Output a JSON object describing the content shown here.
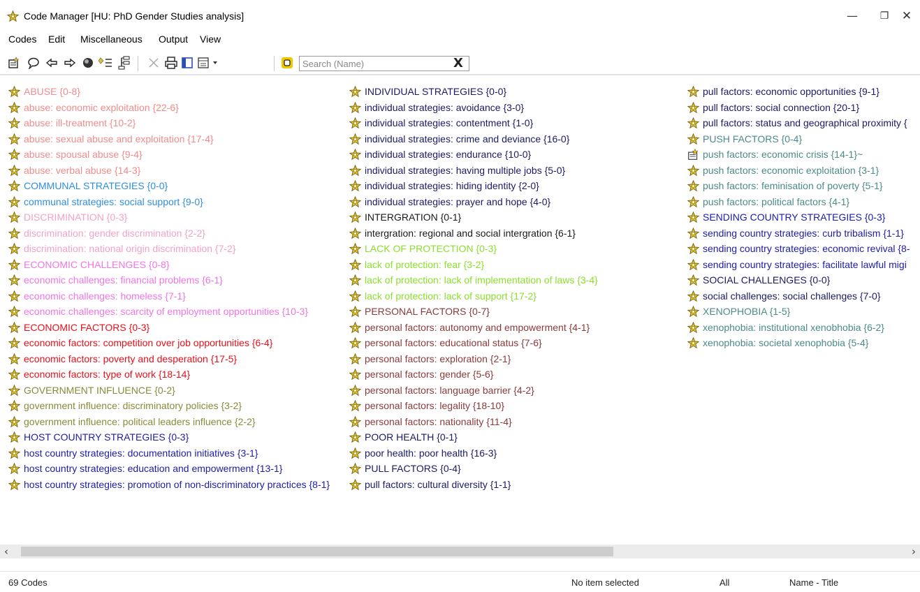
{
  "window": {
    "title": "Code Manager [HU: PhD Gender Studies analysis]",
    "controls": {
      "minimize": "—",
      "maximize": "❐",
      "close": "✕"
    }
  },
  "menubar": [
    "Codes",
    "Edit",
    "Miscellaneous",
    "Output",
    "View"
  ],
  "toolbar": {
    "icons": [
      "new-code-icon",
      "comment-icon",
      "arrow-left-icon",
      "arrow-right-icon",
      "color-icon",
      "filter-icon",
      "tree-icon",
      "delete-icon",
      "print-icon",
      "panel-icon",
      "view-dropdown-icon",
      "highlight-icon"
    ],
    "search": {
      "placeholder": "Search (Name)",
      "value": "",
      "clear": "X"
    }
  },
  "colors": {
    "abuse": "#f28b8b",
    "communal": "#2f8fe0",
    "discrimination": "#f2a2c8",
    "economic_challenges": "#f075e6",
    "economic_factors": "#e8101a",
    "government": "#8a8a3a",
    "host_country": "#1c1ca8",
    "individual": "#1a1a66",
    "lack_of_protection": "#8ae02a",
    "personal_factors": "#8a3a3a",
    "poor_health": "#1a1a66",
    "pull_factors": "#2a2a2a",
    "push_factors": "#4c8a8a",
    "sending_country": "#1c1ca8",
    "social_challenges": "#1a1a66",
    "xenophobia": "#4c8a8a",
    "icon_gold": "#e3c22a"
  },
  "codes": {
    "column1": [
      {
        "label": "ABUSE {0-8}",
        "color": "#f28b8b"
      },
      {
        "label": "abuse: economic exploitation {22-6}",
        "color": "#f28b8b"
      },
      {
        "label": "abuse: ill-treatment {10-2}",
        "color": "#f28b8b"
      },
      {
        "label": "abuse: sexual abuse and exploitation {17-4}",
        "color": "#f28b8b"
      },
      {
        "label": "abuse: spousal abuse {9-4}",
        "color": "#f28b8b"
      },
      {
        "label": "abuse: verbal abuse {14-3}",
        "color": "#f28b8b"
      },
      {
        "label": "COMMUNAL STRATEGIES {0-0}",
        "color": "#2f8fe0"
      },
      {
        "label": "communal strategies: social support {9-0}",
        "color": "#2f8fe0"
      },
      {
        "label": "DISCRIMINATION {0-3}",
        "color": "#f2a2c8"
      },
      {
        "label": "discrimination: gender discrimination {2-2}",
        "color": "#f2a2c8"
      },
      {
        "label": "discrimination: national origin discrimination {7-2}",
        "color": "#f2a2c8"
      },
      {
        "label": "ECONOMIC CHALLENGES {0-8}",
        "color": "#f075e6"
      },
      {
        "label": "economic challenges: financial problems {6-1}",
        "color": "#f075e6"
      },
      {
        "label": "economic challenges: homeless {7-1}",
        "color": "#f075e6"
      },
      {
        "label": "economic challenges: scarcity of employment opportunities {10-3}",
        "color": "#f075e6"
      },
      {
        "label": "ECONOMIC FACTORS {0-3}",
        "color": "#e8101a"
      },
      {
        "label": "economic factors: competition over job opportunities {6-4}",
        "color": "#e8101a"
      },
      {
        "label": "economic factors: poverty and desperation {17-5}",
        "color": "#e8101a"
      },
      {
        "label": "economic factors: type of work {18-14}",
        "color": "#e8101a"
      },
      {
        "label": "GOVERNMENT INFLUENCE {0-2}",
        "color": "#8a8a3a"
      },
      {
        "label": "government influence: discriminatory policies {3-2}",
        "color": "#8a8a3a"
      },
      {
        "label": "government influence: political leaders influence {2-2}",
        "color": "#8a8a3a"
      },
      {
        "label": "HOST COUNTRY STRATEGIES {0-3}",
        "color": "#1c1ca8"
      },
      {
        "label": "host country strategies: documentation initiatives {3-1}",
        "color": "#1c1ca8"
      },
      {
        "label": "host country strategies: education and empowerment {13-1}",
        "color": "#1c1ca8"
      },
      {
        "label": "host country strategies: promotion of non-discriminatory practices {8-1}",
        "color": "#1c1ca8"
      }
    ],
    "column2": [
      {
        "label": "INDIVIDUAL STRATEGIES {0-0}",
        "color": "#1a1a66"
      },
      {
        "label": "individual strategies: avoidance {3-0}",
        "color": "#1a1a66"
      },
      {
        "label": "individual strategies: contentment {1-0}",
        "color": "#1a1a66"
      },
      {
        "label": "individual strategies: crime and deviance {16-0}",
        "color": "#1a1a66"
      },
      {
        "label": "individual strategies: endurance {10-0}",
        "color": "#1a1a66"
      },
      {
        "label": "individual strategies: having multiple  jobs {5-0}",
        "color": "#1a1a66"
      },
      {
        "label": "individual strategies: hiding identity {2-0}",
        "color": "#1a1a66"
      },
      {
        "label": "individual strategies: prayer and hope {4-0}",
        "color": "#1a1a66"
      },
      {
        "label": "INTERGRATION {0-1}",
        "color": "#1a1a1a"
      },
      {
        "label": "intergration: regional and social intergration {6-1}",
        "color": "#1a1a1a"
      },
      {
        "label": "LACK OF PROTECTION {0-3}",
        "color": "#8ae02a"
      },
      {
        "label": "lack of protection: fear {3-2}",
        "color": "#8ae02a"
      },
      {
        "label": "lack of protection: lack of implementation of laws {3-4}",
        "color": "#8ae02a"
      },
      {
        "label": "lack of protection: lack of support {17-2}",
        "color": "#8ae02a"
      },
      {
        "label": "PERSONAL FACTORS {0-7}",
        "color": "#8a3a3a"
      },
      {
        "label": "personal factors: autonomy and empowerment {4-1}",
        "color": "#8a3a3a"
      },
      {
        "label": "personal factors: educational status {7-6}",
        "color": "#8a3a3a"
      },
      {
        "label": "personal factors: exploration {2-1}",
        "color": "#8a3a3a"
      },
      {
        "label": "personal factors: gender {5-6}",
        "color": "#8a3a3a"
      },
      {
        "label": "personal factors: language barrier {4-2}",
        "color": "#8a3a3a"
      },
      {
        "label": "personal factors: legality {18-10}",
        "color": "#8a3a3a"
      },
      {
        "label": "personal factors: nationality {11-4}",
        "color": "#8a3a3a"
      },
      {
        "label": "POOR HEALTH {0-1}",
        "color": "#1a1a66"
      },
      {
        "label": "poor health: poor health {16-3}",
        "color": "#1a1a66"
      },
      {
        "label": "PULL FACTORS {0-4}",
        "color": "#1a1a66"
      },
      {
        "label": "pull factors: cultural diversity {1-1}",
        "color": "#1a1a66"
      }
    ],
    "column3": [
      {
        "label": "pull factors: economic opportunities {9-1}",
        "color": "#1a1a66"
      },
      {
        "label": "pull factors: social connection {20-1}",
        "color": "#1a1a66"
      },
      {
        "label": "pull factors: status and geographical proximity {",
        "color": "#1a1a66"
      },
      {
        "label": "PUSH FACTORS {0-4}",
        "color": "#4c8a8a"
      },
      {
        "label": "push factors: economic crisis {14-1}~",
        "color": "#4c8a8a",
        "icon": "memo"
      },
      {
        "label": "push factors: economic exploitation {3-1}",
        "color": "#4c8a8a"
      },
      {
        "label": "push factors: feminisation of poverty {5-1}",
        "color": "#4c8a8a"
      },
      {
        "label": "push factors: political factors {4-1}",
        "color": "#4c8a8a"
      },
      {
        "label": "SENDING COUNTRY STRATEGIES {0-3}",
        "color": "#1c1ca8"
      },
      {
        "label": "sending country strategies: curb tribalism {1-1}",
        "color": "#1c1ca8"
      },
      {
        "label": "sending country strategies: economic revival {8-",
        "color": "#1c1ca8"
      },
      {
        "label": "sending country strategies: facilitate lawful migi",
        "color": "#1c1ca8"
      },
      {
        "label": "SOCIAL CHALLENGES {0-0}",
        "color": "#1a1a66"
      },
      {
        "label": "social challenges: social challenges {7-0}",
        "color": "#1a1a66"
      },
      {
        "label": "XENOPHOBIA {1-5}",
        "color": "#4c8a8a"
      },
      {
        "label": "xenophobia: institutional xenobhobia {6-2}",
        "color": "#4c8a8a"
      },
      {
        "label": "xenophobia: societal xenophobia {5-4}",
        "color": "#4c8a8a"
      }
    ]
  },
  "scrollbar": {
    "left_arrow": "‹",
    "right_arrow": "›"
  },
  "status": {
    "count": "69 Codes",
    "selection": "No item selected",
    "filter": "All",
    "sort": "Name - Title"
  }
}
